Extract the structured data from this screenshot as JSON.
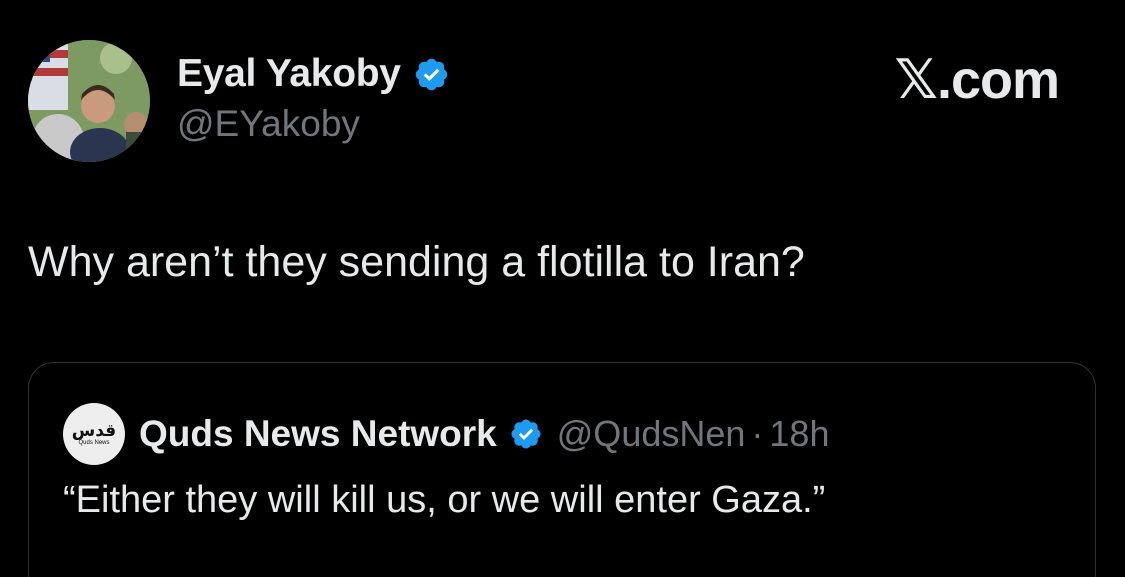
{
  "tweet": {
    "author": {
      "name": "Eyal Yakoby",
      "handle": "@EYakoby",
      "verified": true,
      "avatar_icon": "profile-photo"
    },
    "brand": "𝕏.com",
    "text": "Why aren’t they sending a flotilla to Iran?"
  },
  "quote": {
    "logo": {
      "glyph": "قدس",
      "caption": "Quds News"
    },
    "name": "Quds News Network",
    "verified": true,
    "handle": "@QudsNen",
    "separator": "·",
    "time": "18h",
    "text": "“Either they will kill us, or we will enter Gaza.”"
  },
  "colors": {
    "background": "#000000",
    "text_primary": "#e7e9ea",
    "text_secondary": "#71767b",
    "verified_badge": "#1d9bf0",
    "card_border": "#2f3336"
  }
}
